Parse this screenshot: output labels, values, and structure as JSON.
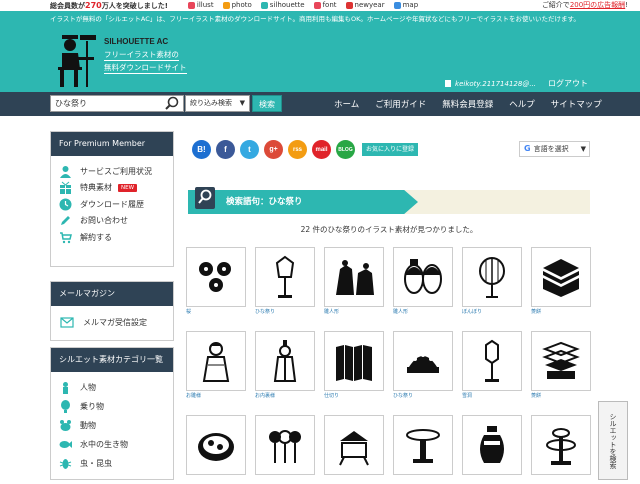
{
  "topbar": {
    "members_prefix": "総会員数が",
    "members_count": "270",
    "members_suffix": "万人を突破しました!",
    "links": [
      "illust",
      "photo",
      "silhouette",
      "font",
      "newyear",
      "map"
    ],
    "ad_prefix": "ご紹介で",
    "ad_link": "200円の広告報酬",
    "ad_suffix": "!"
  },
  "header": {
    "intro": "イラストが無料の「シルエットAC」は、フリーイラスト素材のダウンロードサイト。商用利用も編集もOK。ホームページや年賀状などにもフリーでイラストをお使いいただけます。",
    "brand": "SILHOUETTE AC",
    "tagline1": "フリーイラスト素材の",
    "tagline2": "無料ダウンロードサイト",
    "username": "keikoty.211714128@...",
    "logout": "ログアウト"
  },
  "nav": {
    "search_value": "ひな祭り",
    "narrow_label": "絞り込み検索",
    "search_button": "検索",
    "menu": [
      "ホーム",
      "ご利用ガイド",
      "無料会員登録",
      "ヘルプ",
      "サイトマップ"
    ]
  },
  "sidebar": {
    "premium_title": "For Premium Member",
    "premium_items": [
      "サービスご利用状況",
      "特典素材",
      "ダウンロード履歴",
      "お問い合わせ",
      "解約する"
    ],
    "new_badge": "NEW",
    "mail_title": "メールマガジン",
    "mail_item": "メルマガ受信設定",
    "category_title": "シルエット素材カテゴリ一覧",
    "category_items": [
      "人物",
      "乗り物",
      "動物",
      "水中の生き物",
      "虫・昆虫"
    ]
  },
  "content": {
    "share_labels": [
      "B!",
      "f",
      "t",
      "g+",
      "rss",
      "mail",
      "BLOG"
    ],
    "favorite_label": "お気に入りに登録",
    "translate_label": "言語を選択",
    "result_title": "検索語句：ひな祭り",
    "found_text": "22 件のひな祭りのイラスト素材が見つかりました。",
    "captions": [
      "桜",
      "ひな祭り",
      "雛人形",
      "雛人形",
      "ぼんぼり",
      "菱餅",
      "お雛様",
      "お内裏様",
      "仕切り",
      "ひな祭り",
      "雪洞",
      "菱餅",
      "",
      "",
      "",
      "",
      "",
      ""
    ]
  },
  "side_tab": "シルエットを検索",
  "colors": {
    "teal": "#2db7b1",
    "navy": "#2f4355",
    "red": "#e0232a"
  }
}
